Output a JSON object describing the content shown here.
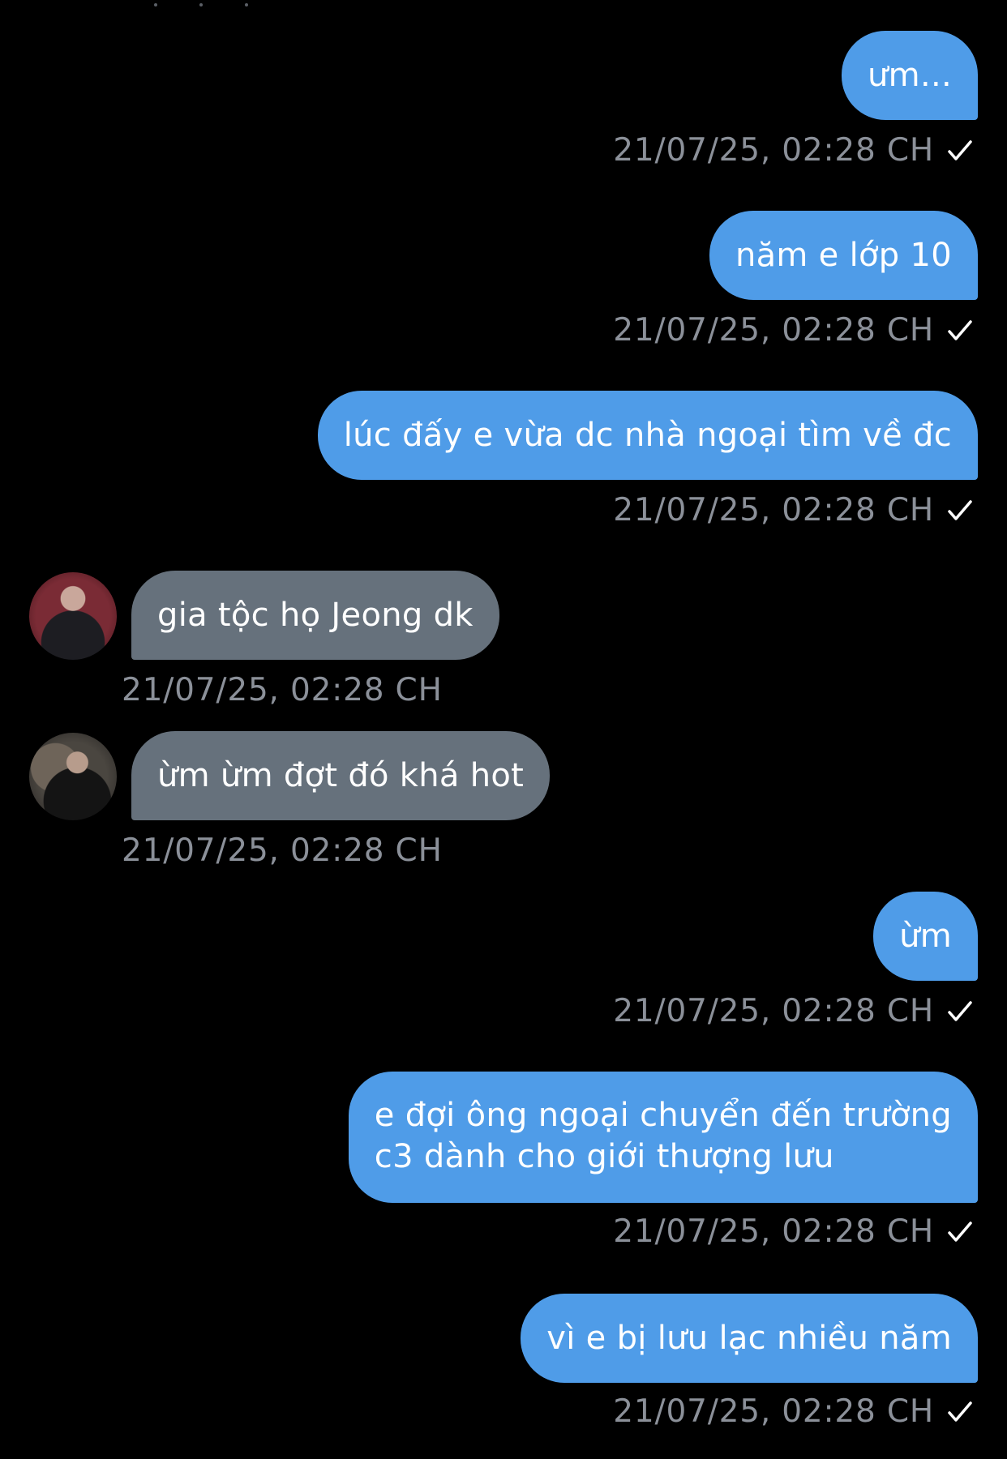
{
  "conversation": {
    "messages": [
      {
        "direction": "out",
        "text": "ưm...",
        "time": "21/07/25, 02:28 CH",
        "read_receipt": "check-icon"
      },
      {
        "direction": "out",
        "text": "năm e lớp 10",
        "time": "21/07/25, 02:28 CH",
        "read_receipt": "check-icon"
      },
      {
        "direction": "out",
        "text": "lúc đấy e vừa dc nhà ngoại tìm về đc",
        "time": "21/07/25, 02:28 CH",
        "read_receipt": "check-icon"
      },
      {
        "direction": "in",
        "text": "gia tộc họ Jeong dk",
        "time": "21/07/25, 02:28 CH",
        "avatar": "avatar-user-1"
      },
      {
        "direction": "in",
        "text": "ừm ừm đợt đó khá hot",
        "time": "21/07/25, 02:28 CH",
        "avatar": "avatar-user-2"
      },
      {
        "direction": "out",
        "text": "ừm",
        "time": "21/07/25, 02:28 CH",
        "read_receipt": "check-icon"
      },
      {
        "direction": "out",
        "text_line1": "e đợi ông ngoại chuyển đến trường",
        "text_line2": "c3 dành cho giới thượng lưu",
        "time": "21/07/25, 02:28 CH",
        "read_receipt": "check-icon"
      },
      {
        "direction": "out",
        "text": "vì e bị lưu lạc nhiều năm",
        "time": "21/07/25, 02:28 CH",
        "read_receipt": "check-icon"
      }
    ]
  },
  "colors": {
    "background": "#000000",
    "outgoing_bubble": "#4f9ce8",
    "incoming_bubble": "#66717c",
    "timestamp": "#8b9099",
    "text": "#ffffff"
  }
}
